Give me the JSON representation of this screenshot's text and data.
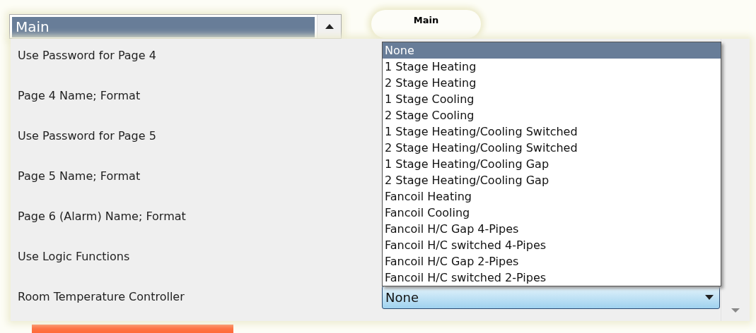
{
  "page_list": {
    "items": [
      {
        "label": "Main",
        "selected": true
      }
    ]
  },
  "tab": {
    "label": "Main"
  },
  "rows": [
    {
      "label": "Use Password for Page 4"
    },
    {
      "label": "Page 4 Name; Format"
    },
    {
      "label": "Use Password for Page 5"
    },
    {
      "label": "Page 5 Name; Format"
    },
    {
      "label": "Page 6 (Alarm) Name; Format"
    },
    {
      "label": "Use Logic Functions"
    },
    {
      "label": "Room Temperature Controller",
      "value": "None"
    }
  ],
  "dropdown": {
    "options": [
      {
        "label": "None",
        "selected": true
      },
      {
        "label": "1 Stage Heating",
        "selected": false
      },
      {
        "label": "2 Stage Heating",
        "selected": false
      },
      {
        "label": "1 Stage Cooling",
        "selected": false
      },
      {
        "label": "2 Stage Cooling",
        "selected": false
      },
      {
        "label": "1 Stage Heating/Cooling Switched",
        "selected": false
      },
      {
        "label": "2 Stage Heating/Cooling Switched",
        "selected": false
      },
      {
        "label": "1 Stage Heating/Cooling Gap",
        "selected": false
      },
      {
        "label": "2 Stage Heating/Cooling Gap",
        "selected": false
      },
      {
        "label": "Fancoil Heating",
        "selected": false
      },
      {
        "label": "Fancoil Cooling",
        "selected": false
      },
      {
        "label": "Fancoil H/C Gap 4-Pipes",
        "selected": false
      },
      {
        "label": "Fancoil H/C switched 4-Pipes",
        "selected": false
      },
      {
        "label": "Fancoil H/C Gap 2-Pipes",
        "selected": false
      },
      {
        "label": "Fancoil H/C switched 2-Pipes",
        "selected": false
      }
    ]
  }
}
